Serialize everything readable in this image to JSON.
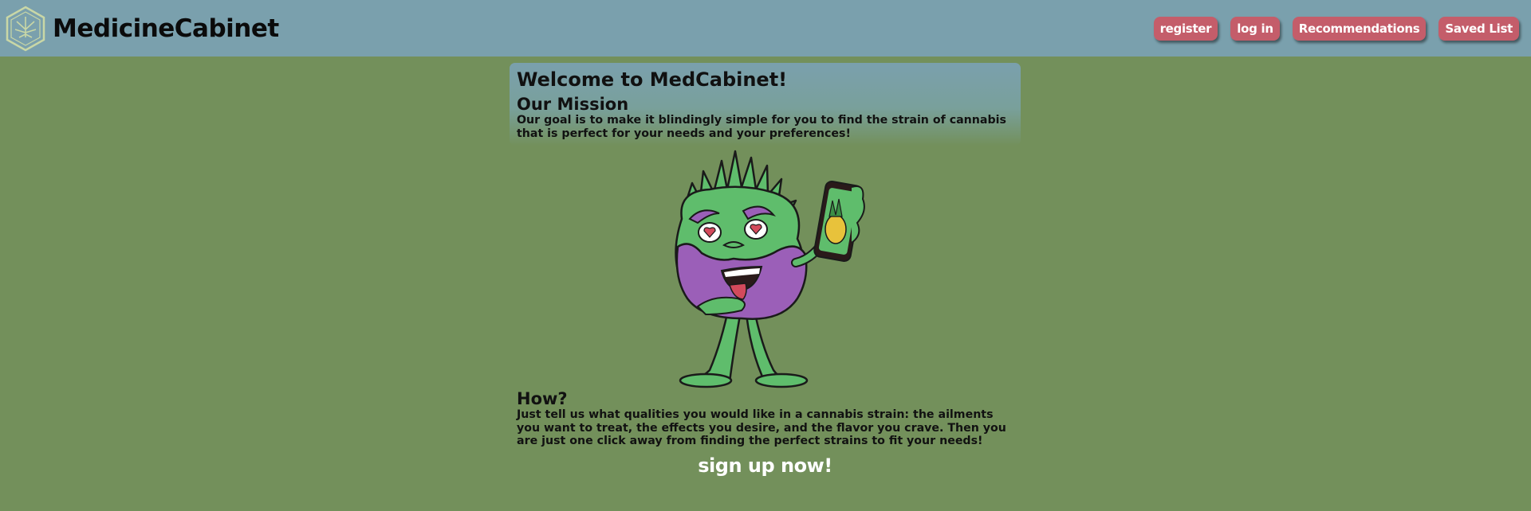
{
  "header": {
    "brand_name": "MedicineCabinet",
    "logo_icon": "hexagon-cannabis-leaf-icon",
    "nav": [
      {
        "label": "register"
      },
      {
        "label": "log in"
      },
      {
        "label": "Recommendations"
      },
      {
        "label": "Saved List"
      }
    ]
  },
  "main": {
    "title": "Welcome to MedCabinet!",
    "mission_heading": "Our Mission",
    "mission_text": "Our goal is to make it blindingly simple for you to find the strain of cannabis that is perfect for your needs and your preferences!",
    "illustration": "cannabis-bud-character-holding-phone-illustration",
    "how_heading": "How?",
    "how_text": "Just tell us what qualities you would like in a cannabis strain: the ailments you want to treat, the effects you desire, and the flavor you crave. Then you are just one click away from finding the perfect strains to fit your needs!",
    "cta": "sign up now!"
  },
  "colors": {
    "header_bg": "#7aa0ad",
    "page_bg": "#73905b",
    "button_bg": "#c45d6a",
    "button_text": "#ffffff"
  }
}
